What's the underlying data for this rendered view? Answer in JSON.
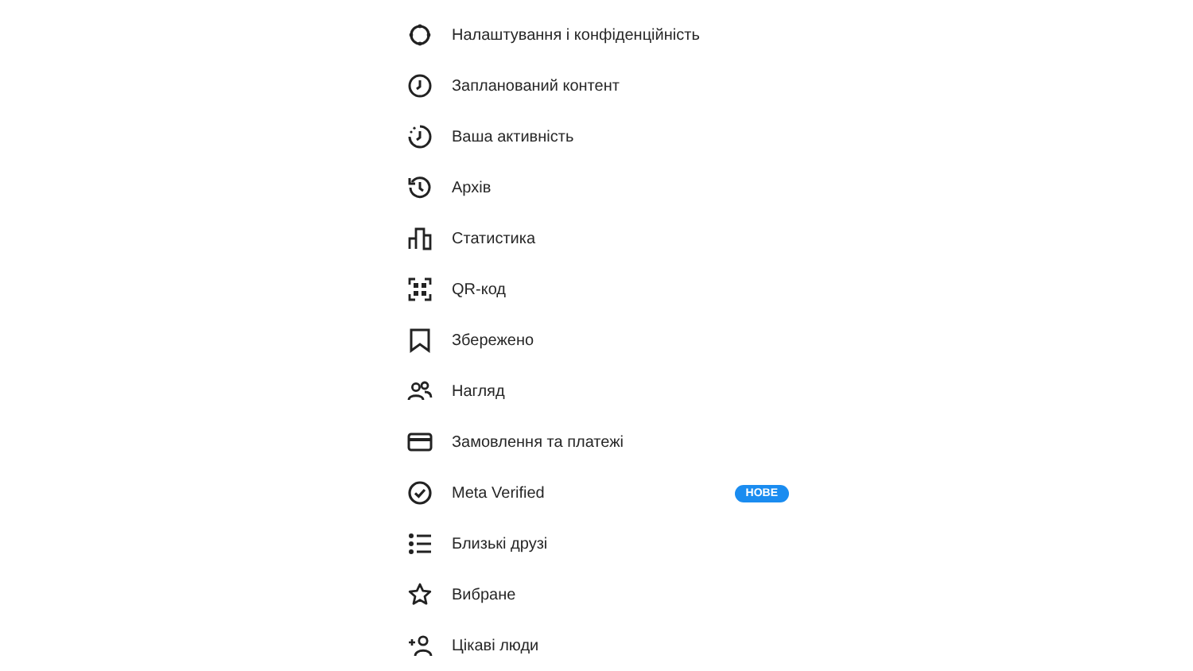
{
  "menu": {
    "items": [
      {
        "label": "Налаштування і конфіденційність"
      },
      {
        "label": "Запланований контент"
      },
      {
        "label": "Ваша активність"
      },
      {
        "label": "Архів"
      },
      {
        "label": "Статистика"
      },
      {
        "label": "QR-код"
      },
      {
        "label": "Збережено"
      },
      {
        "label": "Нагляд"
      },
      {
        "label": "Замовлення та платежі"
      },
      {
        "label": "Meta Verified",
        "badge": "НОВЕ"
      },
      {
        "label": "Близькі друзі"
      },
      {
        "label": "Вибране"
      },
      {
        "label": "Цікаві люди"
      }
    ]
  }
}
